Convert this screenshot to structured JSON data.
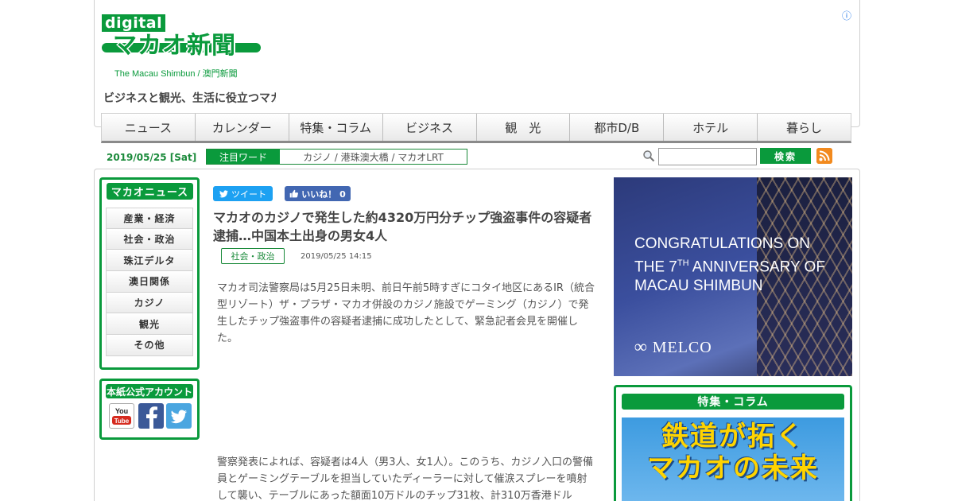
{
  "header": {
    "logo_digital": "digital",
    "logo_main": "マカオ新聞",
    "logo_sub": "The Macau Shimbun / 澳門新聞",
    "tagline": "ビジネスと観光、生活に役立つマカ",
    "ad_info": "ⓘ"
  },
  "nav": {
    "items": [
      "ニュース",
      "カレンダー",
      "特集・コラム",
      "ビジネス",
      "観　光",
      "都市D/B",
      "ホテル",
      "暮らし"
    ]
  },
  "subbar": {
    "date": "2019/05/25 [Sat]",
    "hot_label": "注目ワード",
    "hot_words": "カジノ / 港珠澳大橋 / マカオLRT",
    "search_placeholder": "",
    "search_button": "検索"
  },
  "sidebar": {
    "title": "マカオニュース",
    "items": [
      "産業・経済",
      "社会・政治",
      "珠江デルタ",
      "澳日関係",
      "カジノ",
      "観光",
      "その他"
    ],
    "account_title": "本紙公式アカウント",
    "youtube_label": "You Tube"
  },
  "article": {
    "tweet_label": "ツイート",
    "like_label": "いいね！ 0",
    "headline": "マカオのカジノで発生した約4320万円分チップ強盗事件の容疑者逮捕…中国本土出身の男女4人",
    "category": "社会・政治",
    "timestamp": "2019/05/25 14:15",
    "para1": "マカオ司法警察局は5月25日未明、前日午前5時すぎにコタイ地区にあるIR（統合型リゾート）ザ・プラザ・マカオ併設のカジノ施設でゲーミング（カジノ）で発生したチップ強盗事件の容疑者逮捕に成功したとして、緊急記者会見を開催した。",
    "para2": "警察発表によれば、容疑者は4人（男3人、女1人）。このうち、カジノ入口の警備員とゲーミングテーブルを担当していたディーラーに対して催涙スプレーを噴射して襲い、テーブルにあった額面10万ドルのチップ31枚、計310万香港ドル"
  },
  "right": {
    "banner_line1": "CONGRATULATIONS ON",
    "banner_line2_a": "THE 7",
    "banner_line2_sup": "TH",
    "banner_line2_b": " ANNIVERSARY OF",
    "banner_line3": "MACAU SHIMBUN",
    "banner_brand": "MELCO",
    "feature_title": "特集・コラム",
    "feature_line1": "鉄道が拓く",
    "feature_line2": "マカオの未来"
  },
  "colors": {
    "brand_green": "#0a9a3c",
    "twitter": "#1da1f2",
    "facebook": "#4267b2",
    "rss": "#f28a1e"
  }
}
